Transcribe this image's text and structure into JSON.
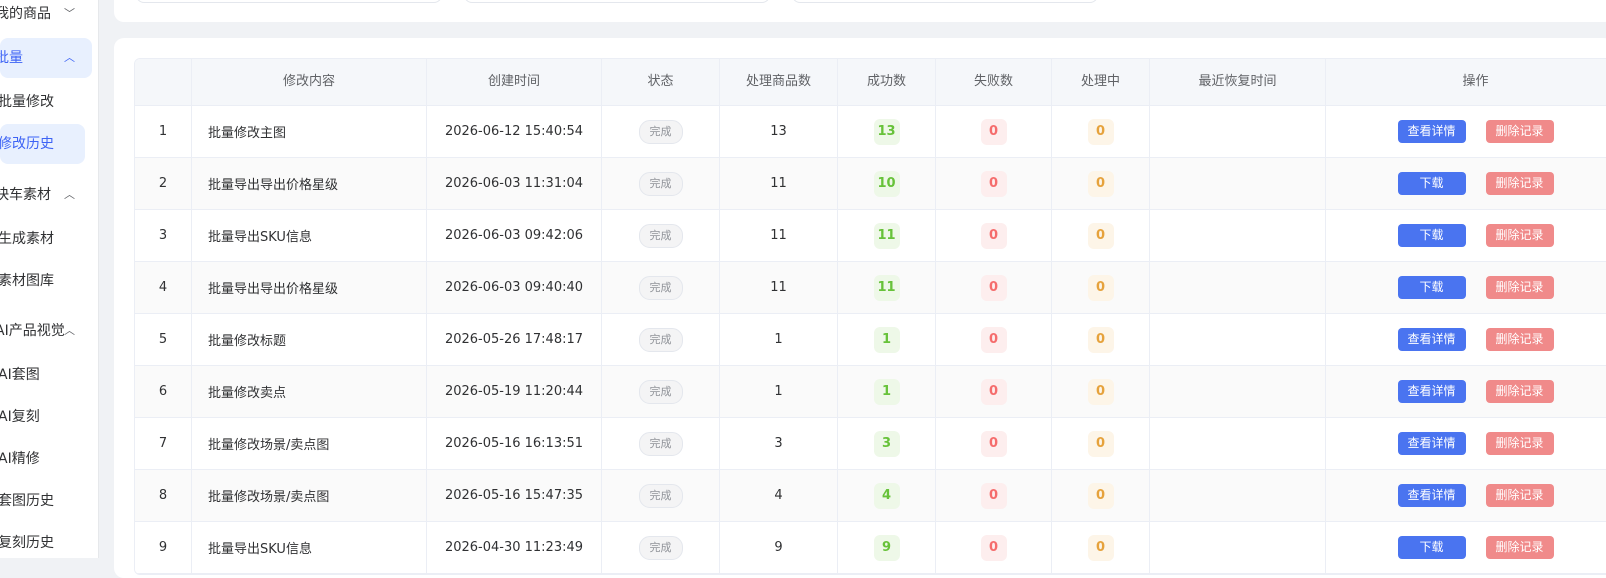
{
  "sidebar": {
    "items": [
      {
        "label": "我的商品",
        "type": "group",
        "chevron": "down",
        "active": false
      },
      {
        "label": "批量",
        "type": "group",
        "chevron": "up",
        "active": true
      },
      {
        "label": "批量修改",
        "type": "sub",
        "active": false
      },
      {
        "label": "修改历史",
        "type": "sub",
        "active": true
      },
      {
        "label": "快车素材",
        "type": "group",
        "chevron": "up",
        "active": false
      },
      {
        "label": "生成素材",
        "type": "sub",
        "active": false
      },
      {
        "label": "素材图库",
        "type": "sub",
        "active": false
      },
      {
        "label": "AI产品视觉",
        "type": "group",
        "chevron": "up",
        "active": false
      },
      {
        "label": "AI套图",
        "type": "sub",
        "active": false
      },
      {
        "label": "AI复刻",
        "type": "sub",
        "active": false
      },
      {
        "label": "AI精修",
        "type": "sub",
        "active": false
      },
      {
        "label": "套图历史",
        "type": "sub",
        "active": false
      },
      {
        "label": "复刻历史",
        "type": "sub",
        "active": false
      }
    ]
  },
  "table": {
    "headers": [
      "",
      "修改内容",
      "创建时间",
      "状态",
      "处理商品数",
      "成功数",
      "失败数",
      "处理中",
      "最近恢复时间",
      "操作"
    ],
    "rows": [
      {
        "index": "1",
        "content": "批量修改主图",
        "created": "2026-06-12 15:40:54",
        "status": "完成",
        "total": "13",
        "success": "13",
        "fail": "0",
        "pending": "0",
        "recovered": "",
        "action1": "查看详情",
        "action2": "删除记录"
      },
      {
        "index": "2",
        "content": "批量导出导出价格星级",
        "created": "2026-06-03 11:31:04",
        "status": "完成",
        "total": "11",
        "success": "10",
        "fail": "0",
        "pending": "0",
        "recovered": "",
        "action1": "下载",
        "action2": "删除记录"
      },
      {
        "index": "3",
        "content": "批量导出SKU信息",
        "created": "2026-06-03 09:42:06",
        "status": "完成",
        "total": "11",
        "success": "11",
        "fail": "0",
        "pending": "0",
        "recovered": "",
        "action1": "下载",
        "action2": "删除记录"
      },
      {
        "index": "4",
        "content": "批量导出导出价格星级",
        "created": "2026-06-03 09:40:40",
        "status": "完成",
        "total": "11",
        "success": "11",
        "fail": "0",
        "pending": "0",
        "recovered": "",
        "action1": "下载",
        "action2": "删除记录"
      },
      {
        "index": "5",
        "content": "批量修改标题",
        "created": "2026-05-26 17:48:17",
        "status": "完成",
        "total": "1",
        "success": "1",
        "fail": "0",
        "pending": "0",
        "recovered": "",
        "action1": "查看详情",
        "action2": "删除记录"
      },
      {
        "index": "6",
        "content": "批量修改卖点",
        "created": "2026-05-19 11:20:44",
        "status": "完成",
        "total": "1",
        "success": "1",
        "fail": "0",
        "pending": "0",
        "recovered": "",
        "action1": "查看详情",
        "action2": "删除记录"
      },
      {
        "index": "7",
        "content": "批量修改场景/卖点图",
        "created": "2026-05-16 16:13:51",
        "status": "完成",
        "total": "3",
        "success": "3",
        "fail": "0",
        "pending": "0",
        "recovered": "",
        "action1": "查看详情",
        "action2": "删除记录"
      },
      {
        "index": "8",
        "content": "批量修改场景/卖点图",
        "created": "2026-05-16 15:47:35",
        "status": "完成",
        "total": "4",
        "success": "4",
        "fail": "0",
        "pending": "0",
        "recovered": "",
        "action1": "查看详情",
        "action2": "删除记录"
      },
      {
        "index": "9",
        "content": "批量导出SKU信息",
        "created": "2026-04-30 11:23:49",
        "status": "完成",
        "total": "9",
        "success": "9",
        "fail": "0",
        "pending": "0",
        "recovered": "",
        "action1": "下载",
        "action2": "删除记录"
      }
    ]
  },
  "colors": {
    "primary": "#4a74f0",
    "danger": "#f08a8a",
    "success": "#67c23a",
    "fail": "#f56c6c",
    "pending": "#e6a23c",
    "active_bg": "#e8f0fe"
  }
}
